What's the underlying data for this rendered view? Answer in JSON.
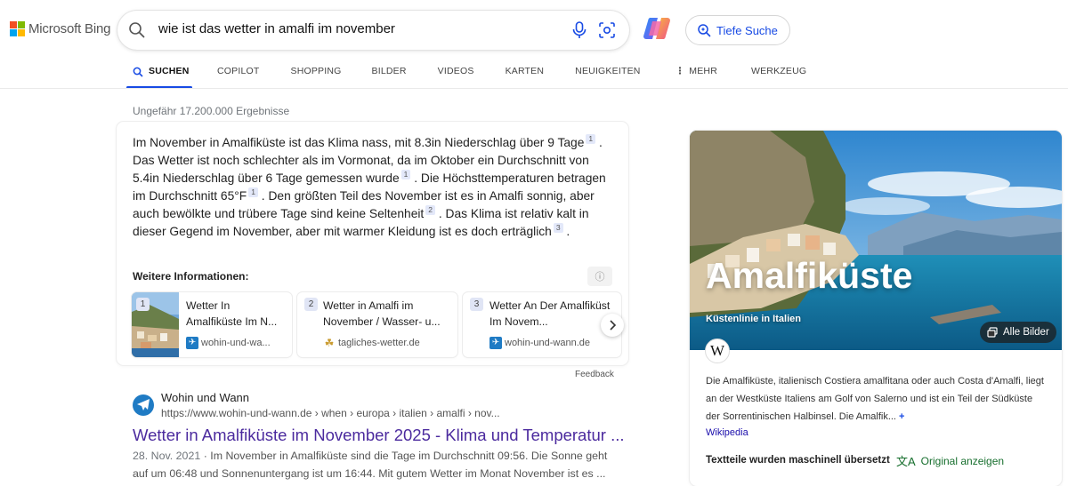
{
  "brand": {
    "name": "Microsoft Bing",
    "colors": [
      "#f25022",
      "#7fba00",
      "#00a4ef",
      "#ffb900"
    ]
  },
  "search": {
    "query": "wie ist das wetter in amalfi im november"
  },
  "header": {
    "deep_search": "Tiefe Suche"
  },
  "nav": {
    "items": [
      {
        "label": "SUCHEN",
        "active": true
      },
      {
        "label": "COPILOT"
      },
      {
        "label": "SHOPPING"
      },
      {
        "label": "BILDER"
      },
      {
        "label": "VIDEOS"
      },
      {
        "label": "KARTEN"
      },
      {
        "label": "NEUIGKEITEN"
      },
      {
        "label": "MEHR"
      },
      {
        "label": "WERKZEUG"
      }
    ]
  },
  "results": {
    "count": "Ungefähr 17.200.000 Ergebnisse",
    "answer": {
      "segments": [
        {
          "text": "Im November in Amalfiküste ist das Klima nass, mit 8.3in Niederschlag über 9 Tage",
          "cite": "1"
        },
        {
          "text": ". Das Wetter ist noch schlechter als im Vormonat, da im Oktober ein Durchschnitt von 5.4in Niederschlag über 6 Tage gemessen wurde",
          "cite": "1"
        },
        {
          "text": ". Die Höchsttemperaturen betragen im Durchschnitt 65°F",
          "cite": "1"
        },
        {
          "text": ". Den größten Teil des November ist es in Amalfi sonnig, aber auch bewölkte und trübere Tage sind keine Seltenheit",
          "cite": "2"
        },
        {
          "text": ". Das Klima ist relativ kalt in dieser Gegend im November, aber mit warmer Kleidung ist es doch erträglich",
          "cite": "3"
        },
        {
          "text": ".",
          "cite": ""
        }
      ],
      "more_info_label": "Weitere Informationen:",
      "sources": [
        {
          "num": "1",
          "title": "Wetter In Amalfiküste Im N...",
          "domain": "wohin-und-wa..."
        },
        {
          "num": "2",
          "title": "Wetter in Amalfi im November / Wasser- u...",
          "domain": "tagliches-wetter.de"
        },
        {
          "num": "3",
          "title": "Wetter An Der Amalfiküst Im Novem...",
          "domain": "wohin-und-wann.de"
        }
      ],
      "feedback": "Feedback"
    },
    "web": {
      "site_name": "Wohin und Wann",
      "url": "https://www.wohin-und-wann.de › when › europa › italien › amalfi › nov...",
      "title": "Wetter in Amalfiküste im November 2025 - Klima und Temperatur ...",
      "date": "28. Nov. 2021",
      "snippet": "Im November in Amalfiküste sind die Tage im Durchschnitt 09:56. Die Sonne geht auf um 06:48 und Sonnenuntergang ist um 16:44. Mit gutem Wetter im Monat November ist es ..."
    }
  },
  "knowledge_panel": {
    "title": "Amalfiküste",
    "subtitle": "Küstenlinie in Italien",
    "all_images": "Alle Bilder",
    "wiki_badge": "W",
    "description": "Die Amalfiküste, italienisch Costiera amalfitana oder auch Costa d'Amalfi, liegt an der Westküste Italiens am Golf von Salerno und ist ein Teil der Südküste der Sorrentinischen Halbinsel. Die Amalfik...",
    "more": "+",
    "source": "Wikipedia",
    "translated_note": "Textteile wurden maschinell übersetzt",
    "original_link": "Original anzeigen"
  }
}
